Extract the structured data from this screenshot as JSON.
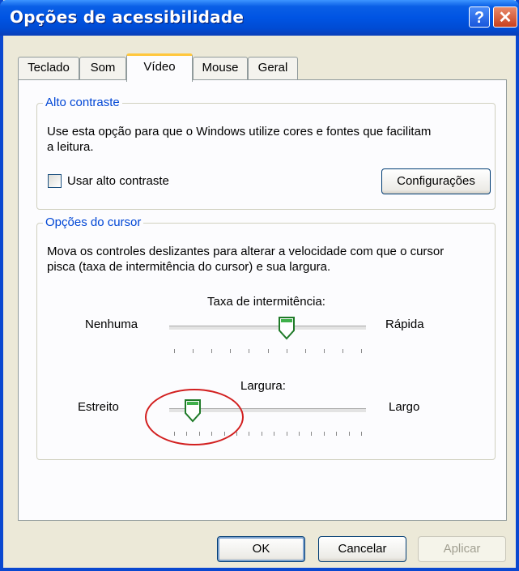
{
  "window": {
    "title": "Opções de acessibilidade",
    "help_glyph": "?",
    "close_glyph": "✕"
  },
  "tabs": [
    {
      "label": "Teclado"
    },
    {
      "label": "Som"
    },
    {
      "label": "Vídeo"
    },
    {
      "label": "Mouse"
    },
    {
      "label": "Geral"
    }
  ],
  "high_contrast": {
    "legend": "Alto contraste",
    "description_line1": "Use esta opção para que o Windows utilize cores e fontes que facilitam",
    "description_line2": "a leitura.",
    "checkbox_label": "Usar alto contraste",
    "checked": false,
    "settings_button": "Configurações"
  },
  "cursor": {
    "legend": "Opções do cursor",
    "description_line1": "Mova os controles deslizantes para alterar a velocidade com que o cursor",
    "description_line2": "pisca (taxa de intermitência do cursor) e sua largura.",
    "blink": {
      "label": "Taxa de intermitência:",
      "min_label": "Nenhuma",
      "max_label": "Rápida",
      "position": 0.6,
      "tick_count": 11
    },
    "width": {
      "label": "Largura:",
      "min_label": "Estreito",
      "max_label": "Largo",
      "position": 0.1,
      "tick_count": 16
    }
  },
  "footer": {
    "ok": "OK",
    "cancel": "Cancelar",
    "apply": "Aplicar"
  },
  "colors": {
    "title_bar": "#0054e3",
    "legend_text": "#0046d5",
    "annotation": "#d21f1f",
    "tab_highlight": "#ffc73c"
  }
}
